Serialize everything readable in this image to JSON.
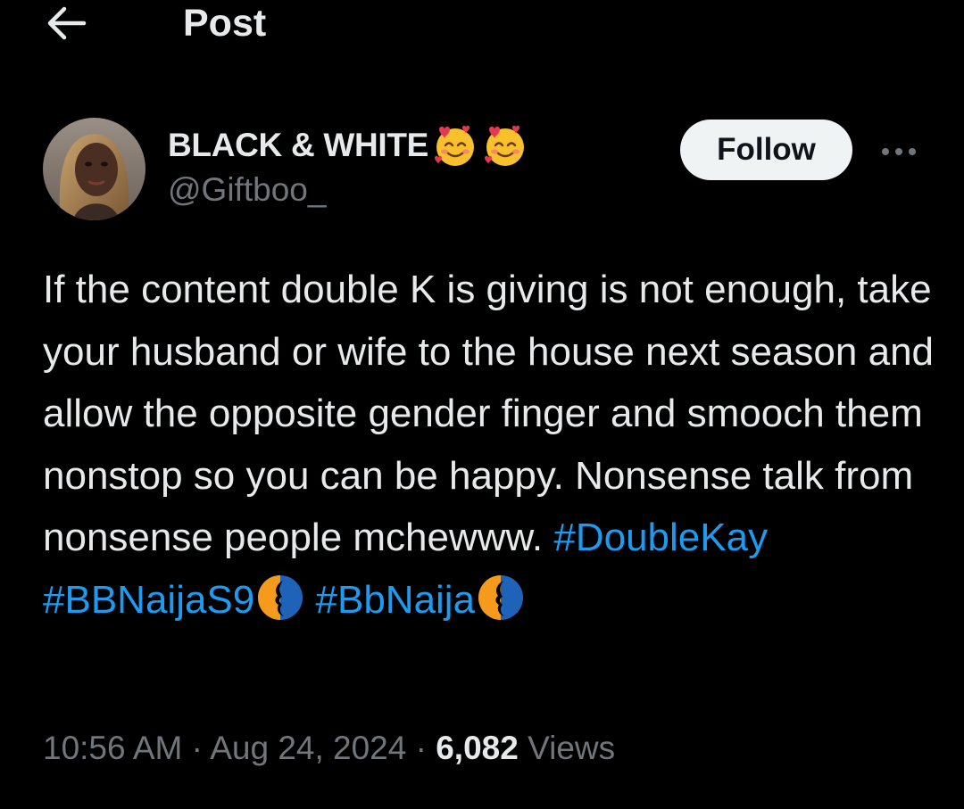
{
  "header": {
    "back_icon": "arrow-left-icon",
    "title": "Post"
  },
  "author": {
    "display_name": "BLACK & WHITE",
    "name_emojis": [
      "smiling-face-with-hearts-icon",
      "smiling-face-with-hearts-icon"
    ],
    "handle": "@Giftboo_",
    "avatar": "avatar"
  },
  "actions": {
    "follow_label": "Follow",
    "more_icon": "more-horizontal-icon"
  },
  "tweet": {
    "text": "If the content double K is giving is not enough, take your husband or wife to the house next season and allow the opposite gender finger and smooch them nonstop so you can be happy. Nonsense talk from nonsense people mchewww.",
    "hashtags": [
      "#DoubleKay",
      "#BBNaijaS9",
      "#BbNaija"
    ],
    "hashtag_emoji": "bbnaija-logo-icon"
  },
  "meta": {
    "time": "10:56 AM",
    "separator": "·",
    "date": "Aug 24, 2024",
    "views_count": "6,082",
    "views_label": "Views"
  },
  "colors": {
    "background": "#000000",
    "text": "#e7e9ea",
    "secondary": "#71767b",
    "link": "#1d9bf0",
    "follow_bg": "#eff3f4"
  }
}
